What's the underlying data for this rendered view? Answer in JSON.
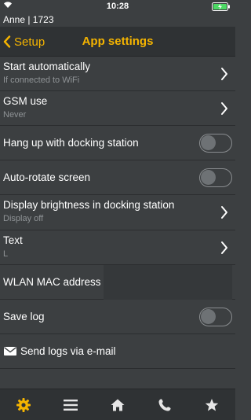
{
  "status": {
    "time": "10:28",
    "wifi_icon": "wifi-icon",
    "battery_icon": "battery-charging-icon",
    "battery_color": "#4cd964"
  },
  "user": {
    "label": "Anne | 1723"
  },
  "nav": {
    "back_label": "Setup",
    "title": "App settings",
    "accent": "#f5b400"
  },
  "rows": [
    {
      "label": "Start automatically",
      "sub": "If connected to WiFi",
      "control": "chevron"
    },
    {
      "label": "GSM use",
      "sub": "Never",
      "control": "chevron"
    },
    {
      "label": "Hang up with docking station",
      "control": "toggle",
      "on": false
    },
    {
      "label": "Auto-rotate screen",
      "control": "toggle",
      "on": false
    },
    {
      "label": "Display brightness in docking station",
      "sub": "Display off",
      "control": "chevron"
    },
    {
      "label": "Text",
      "sub": "L",
      "control": "chevron"
    },
    {
      "label": "WLAN MAC address",
      "value": "",
      "control": "field"
    },
    {
      "label": "Save log",
      "control": "toggle",
      "on": false
    },
    {
      "label": "Send logs via e-mail",
      "control": "action",
      "icon": "mail-icon"
    }
  ],
  "tabs": [
    {
      "icon": "gear-icon",
      "active": true
    },
    {
      "icon": "list-icon",
      "active": false
    },
    {
      "icon": "home-icon",
      "active": false
    },
    {
      "icon": "phone-icon",
      "active": false
    },
    {
      "icon": "star-icon",
      "active": false
    }
  ]
}
